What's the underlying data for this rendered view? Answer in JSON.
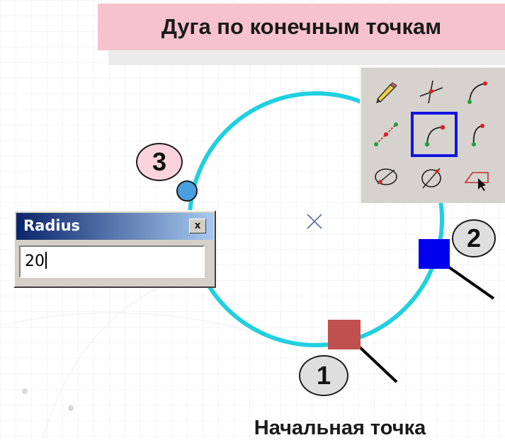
{
  "header": {
    "title": "Дуга по конечным точкам"
  },
  "canvas": {
    "arc_color": "#1fd0e0",
    "start_point_color": "#c0504d",
    "end_point_color": "#0000ee",
    "mid_point_color": "#4a9fe0",
    "center_marker_icon": "cross-marker"
  },
  "markers": {
    "one": "1",
    "two": "2",
    "three": "3"
  },
  "toolbar": {
    "buttons": [
      {
        "icon": "pencil-icon"
      },
      {
        "icon": "point-on-line-icon"
      },
      {
        "icon": "arc-tangent-icon"
      },
      {
        "icon": "line-icon"
      },
      {
        "icon": "arc-by-endpoints-icon",
        "selected": true
      },
      {
        "icon": "arc-through-point-icon"
      },
      {
        "icon": "circle-cross-icon"
      },
      {
        "icon": "ellipse-icon"
      },
      {
        "icon": "shape-select-icon"
      }
    ],
    "selection_color": "#1212e0"
  },
  "dialog": {
    "title": "Radius",
    "value": "20",
    "close_label": "x"
  },
  "caption": "Начальная точка"
}
